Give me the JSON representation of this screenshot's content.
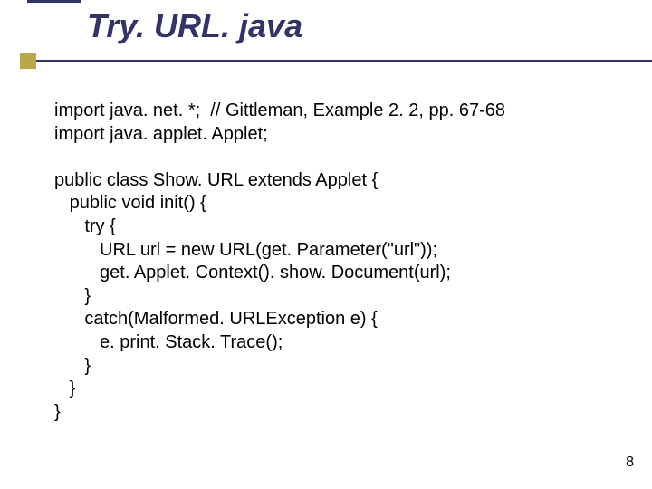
{
  "title": "Try. URL. java",
  "code": "import java. net. *;  // Gittleman, Example 2. 2, pp. 67-68\nimport java. applet. Applet;\n\npublic class Show. URL extends Applet {\n   public void init() {\n      try {\n         URL url = new URL(get. Parameter(\"url\"));\n         get. Applet. Context(). show. Document(url);\n      }\n      catch(Malformed. URLException e) {\n         e. print. Stack. Trace();\n      }\n   }\n}",
  "page_number": "8"
}
